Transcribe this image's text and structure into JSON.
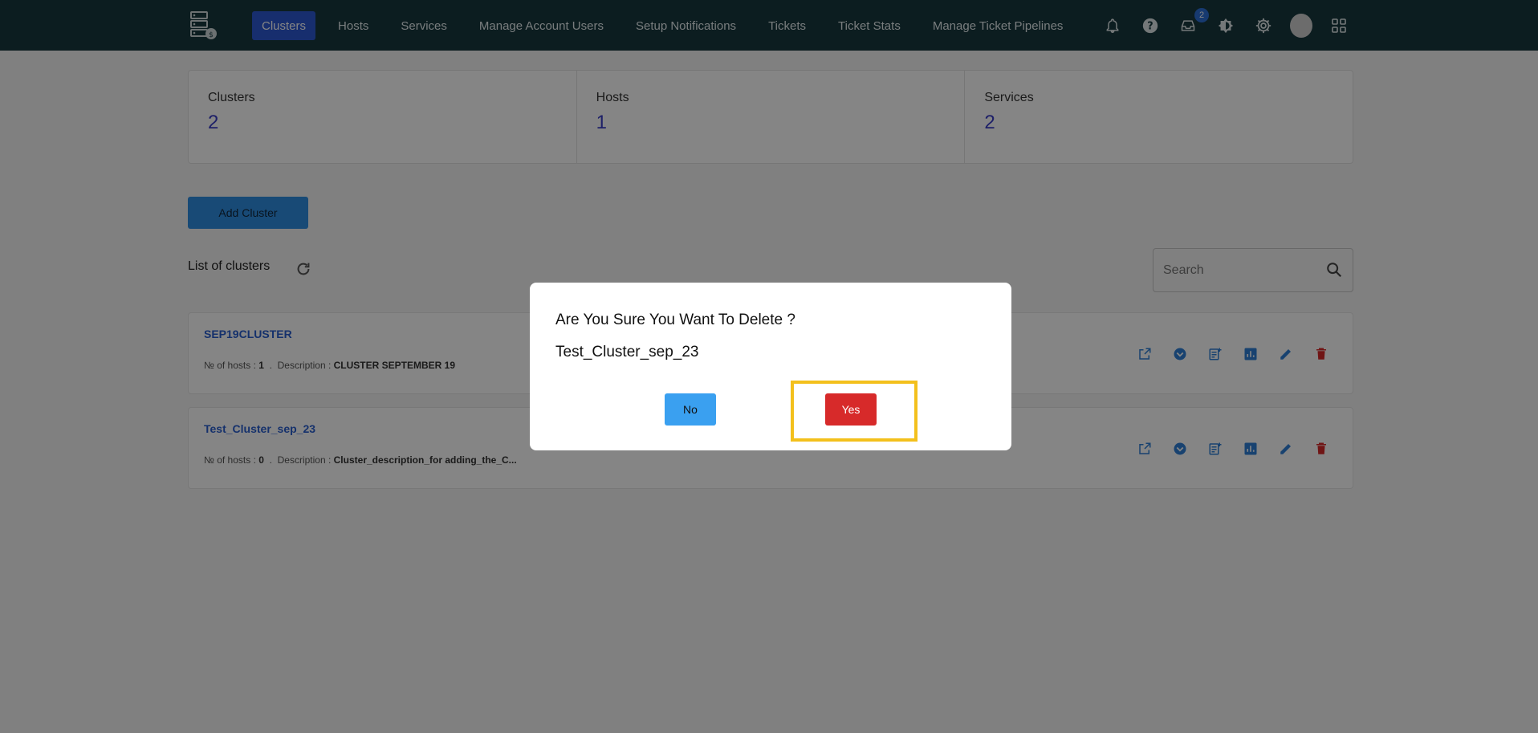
{
  "nav": {
    "items": [
      {
        "label": "Clusters",
        "active": true
      },
      {
        "label": "Hosts"
      },
      {
        "label": "Services"
      },
      {
        "label": "Manage Account Users"
      },
      {
        "label": "Setup Notifications"
      },
      {
        "label": "Tickets"
      },
      {
        "label": "Ticket Stats"
      },
      {
        "label": "Manage Ticket Pipelines"
      }
    ],
    "inbox_badge": "2",
    "icons": [
      "bell-icon",
      "help-icon",
      "inbox-icon",
      "theme-icon",
      "gear-icon",
      "avatar",
      "apps-grid-icon"
    ]
  },
  "stats": [
    {
      "label": "Clusters",
      "value": "2"
    },
    {
      "label": "Hosts",
      "value": "1"
    },
    {
      "label": "Services",
      "value": "2"
    }
  ],
  "add_cluster_label": "Add Cluster",
  "list_title": "List of clusters",
  "search": {
    "placeholder": "Search"
  },
  "clusters": [
    {
      "name": "SEP19CLUSTER",
      "hosts_label": "№ of hosts : ",
      "hosts": "1",
      "desc_label": "Description : ",
      "description": "CLUSTER SEPTEMBER 19"
    },
    {
      "name": "Test_Cluster_sep_23",
      "hosts_label": "№ of hosts : ",
      "hosts": "0",
      "desc_label": "Description : ",
      "description": "Cluster_description_for adding_the_C..."
    }
  ],
  "modal": {
    "title": "Are You Sure You Want To Delete ?",
    "subject": "Test_Cluster_sep_23",
    "no_label": "No",
    "yes_label": "Yes"
  },
  "colors": {
    "topbar": "#17393f",
    "active_nav": "#2d59d4",
    "accent_blue": "#2f8ee3",
    "danger": "#d72a2a",
    "highlight": "#f3c01c"
  }
}
